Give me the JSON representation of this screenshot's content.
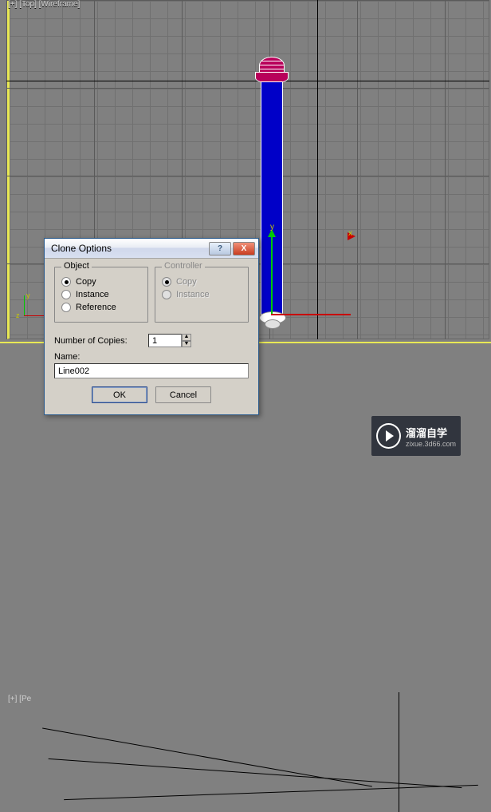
{
  "viewport": {
    "label_top": "[+] [Top] [Wireframe]",
    "label_bottom": "[+] [Pe"
  },
  "gizmo": {
    "x": "x",
    "y": "y",
    "z": "z"
  },
  "dialog": {
    "title": "Clone Options",
    "help": "?",
    "close": "X",
    "groups": {
      "object": {
        "legend": "Object",
        "copy": "Copy",
        "instance": "Instance",
        "reference": "Reference"
      },
      "controller": {
        "legend": "Controller",
        "copy": "Copy",
        "instance": "Instance"
      }
    },
    "copies_label": "Number of Copies:",
    "copies_value": "1",
    "name_label": "Name:",
    "name_value": "Line002",
    "ok": "OK",
    "cancel": "Cancel"
  },
  "badge": {
    "cn": "溜溜自学",
    "url": "zixue.3d66.com"
  }
}
